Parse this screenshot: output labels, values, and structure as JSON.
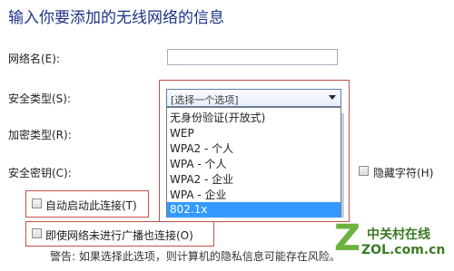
{
  "heading": "输入你要添加的无线网络的信息",
  "fields": {
    "network_name_label": "网络名(E):",
    "security_type_label": "安全类型(S):",
    "encryption_type_label": "加密类型(R):",
    "security_key_label": "安全密钥(C):",
    "hide_chars_label": "隐藏字符(H)",
    "network_name_value": ""
  },
  "security_select": {
    "selected": "[选择一个选项]",
    "options": [
      "无身份验证(开放式)",
      "WEP",
      "WPA2 - 个人",
      "WPA - 个人",
      "WPA2 - 企业",
      "WPA - 企业",
      "802.1x"
    ],
    "highlighted": "802.1x"
  },
  "checkboxes": {
    "auto_connect": "自动启动此连接(T)",
    "connect_non_broadcast": "即使网络未进行广播也连接(O)"
  },
  "warning": "警告: 如果选择此选项，则计算机的隐私信息可能存在风险。",
  "watermark": {
    "mark": "Z",
    "cn": "中关村在线",
    "en": "ZOL.com.cn"
  },
  "colors": {
    "heading": "#1e3287",
    "highlight_red": "#c2504a",
    "selection_blue": "#3399ff"
  }
}
